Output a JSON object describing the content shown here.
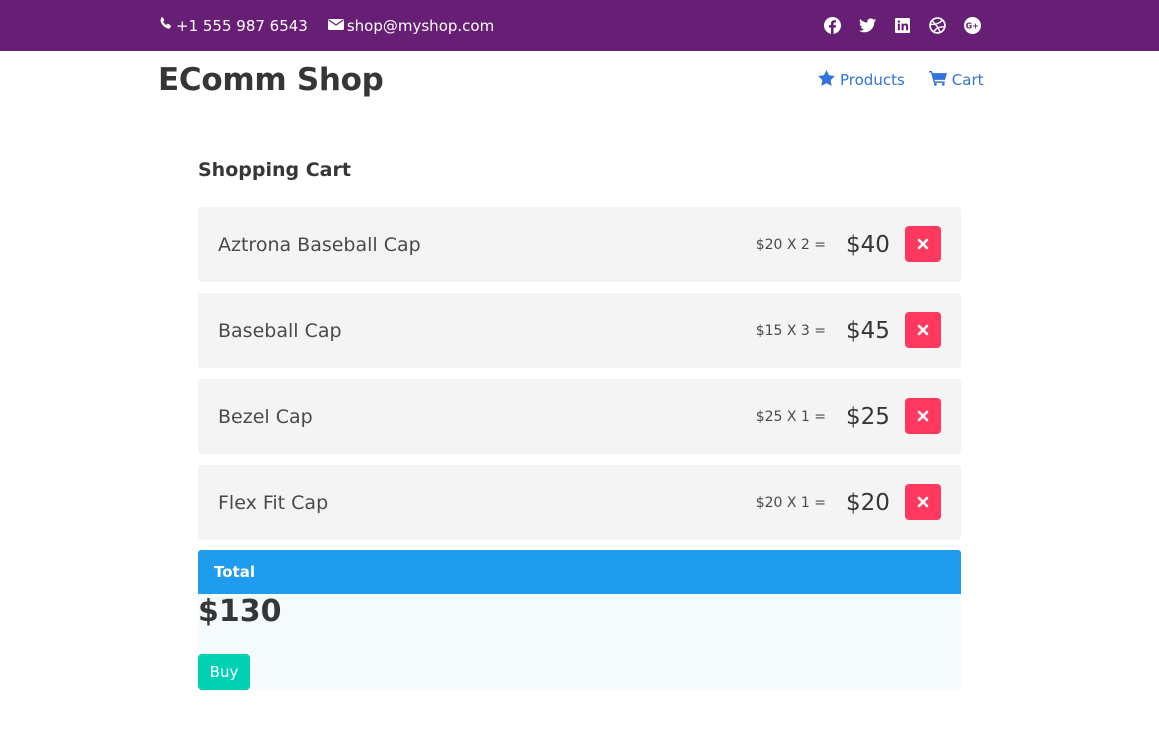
{
  "topbar": {
    "phone": "+1 555 987 6543",
    "email": "shop@myshop.com",
    "social": [
      "facebook-icon",
      "twitter-icon",
      "linkedin-icon",
      "dribbble-icon",
      "google-plus-icon"
    ]
  },
  "brand": "EComm Shop",
  "nav": {
    "products": "Products",
    "cart": "Cart"
  },
  "cart": {
    "title": "Shopping Cart",
    "items": [
      {
        "name": "Aztrona Baseball Cap",
        "calc": "$20 X 2 =",
        "total": "$40"
      },
      {
        "name": "Baseball Cap",
        "calc": "$15 X 3 =",
        "total": "$45"
      },
      {
        "name": "Bezel Cap",
        "calc": "$25 X 1 =",
        "total": "$25"
      },
      {
        "name": "Flex Fit Cap",
        "calc": "$20 X 1 =",
        "total": "$20"
      }
    ]
  },
  "total": {
    "label": "Total",
    "amount": "$130",
    "buy_label": "Buy"
  },
  "colors": {
    "topbar": "#671e75",
    "link": "#3273dc",
    "danger": "#ff3860",
    "info": "#209cee",
    "primary": "#00d1b2"
  }
}
